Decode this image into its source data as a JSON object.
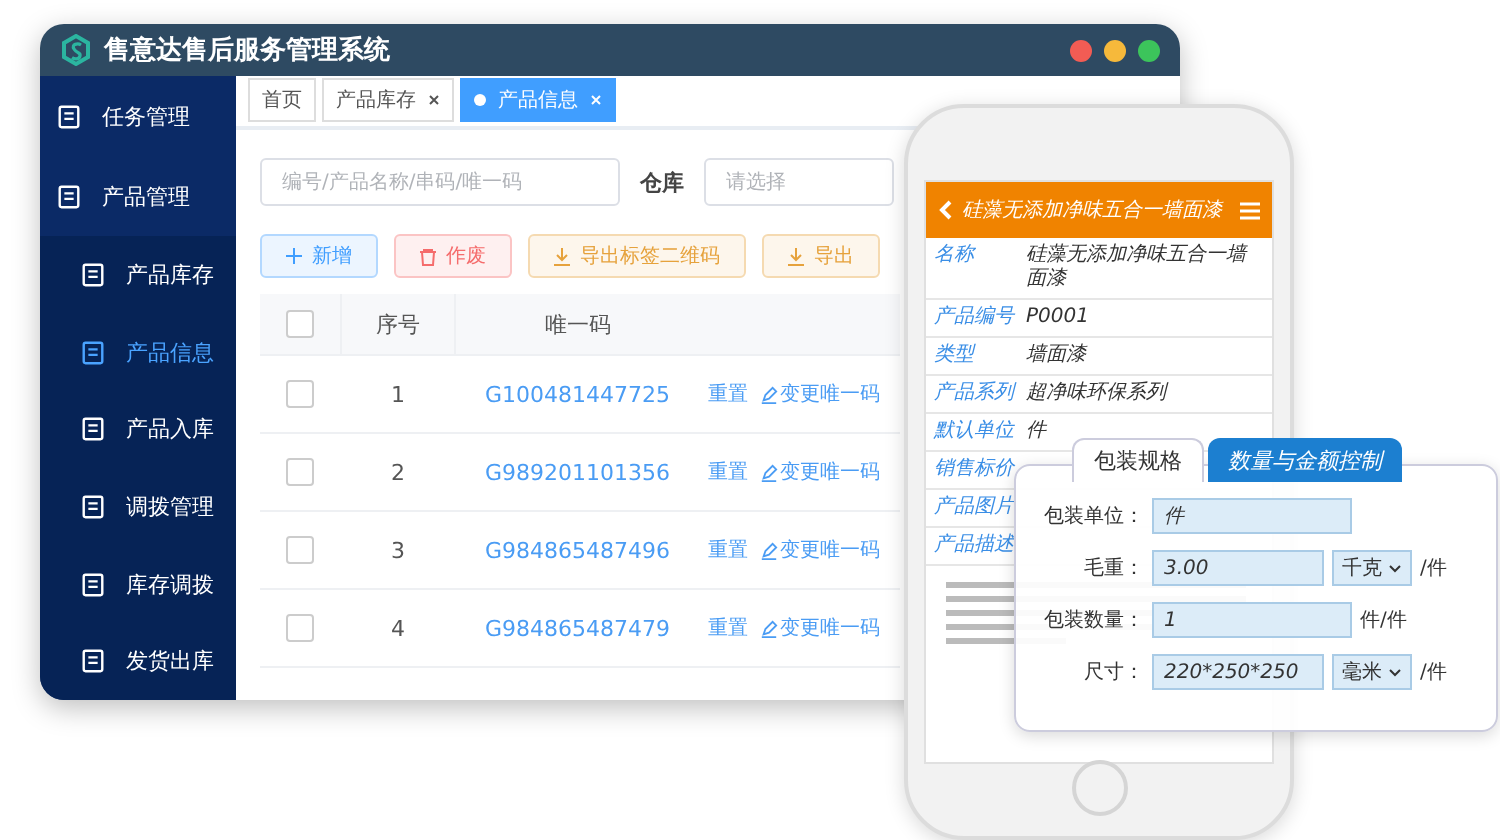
{
  "window": {
    "title": "售意达售后服务管理系统"
  },
  "sidebar": {
    "items": [
      {
        "label": "任务管理",
        "expanded": false
      },
      {
        "label": "产品管理",
        "expanded": true,
        "children": [
          {
            "label": "产品库存",
            "selected": false
          },
          {
            "label": "产品信息",
            "selected": true
          },
          {
            "label": "产品入库",
            "selected": false
          },
          {
            "label": "调拨管理",
            "selected": false
          },
          {
            "label": "库存调拨",
            "selected": false
          },
          {
            "label": "发货出库",
            "selected": false
          }
        ]
      }
    ]
  },
  "tabs": [
    {
      "label": "首页",
      "selected": false,
      "closable": false
    },
    {
      "label": "产品库存",
      "selected": false,
      "closable": true
    },
    {
      "label": "产品信息",
      "selected": true,
      "closable": true
    }
  ],
  "filters": {
    "search": {
      "placeholder": "编号/产品名称/串码/唯一码"
    },
    "warehouse": {
      "label": "仓库",
      "placeholder": "请选择"
    }
  },
  "toolbar": [
    {
      "label": "新增",
      "kind": "add"
    },
    {
      "label": "作废",
      "kind": "void"
    },
    {
      "label": "导出标签二维码",
      "kind": "export"
    },
    {
      "label": "导出",
      "kind": "export"
    }
  ],
  "table": {
    "all_checked": false,
    "columns": [
      "序号",
      "唯一码"
    ],
    "rows": [
      {
        "checked": false,
        "index": "1",
        "code": "G100481447725",
        "actions": [
          "重置",
          "变更唯一码"
        ]
      },
      {
        "checked": false,
        "index": "2",
        "code": "G989201101356",
        "actions": [
          "重置",
          "变更唯一码"
        ]
      },
      {
        "checked": false,
        "index": "3",
        "code": "G984865487496",
        "actions": [
          "重置",
          "变更唯一码"
        ]
      },
      {
        "checked": false,
        "index": "4",
        "code": "G984865487479",
        "actions": [
          "重置",
          "变更唯一码"
        ]
      }
    ]
  },
  "phone": {
    "title": "硅藻无添加净味五合一墙面漆",
    "fields": [
      {
        "label": "名称",
        "value": "硅藻无添加净味五合一墙面漆"
      },
      {
        "label": "产品编号",
        "value": "P0001"
      },
      {
        "label": "类型",
        "value": "墙面漆"
      },
      {
        "label": "产品系列",
        "value": "超净味环保系列"
      },
      {
        "label": "默认单位",
        "value": "件"
      },
      {
        "label": "销售标价"
      },
      {
        "label": "产品图片"
      },
      {
        "label": "产品描述"
      }
    ]
  },
  "card": {
    "tabs": [
      {
        "label": "包装规格",
        "selected": true
      },
      {
        "label": "数量与金额控制",
        "selected": false
      }
    ],
    "fields": [
      {
        "label": "包装单位：",
        "value": "件"
      },
      {
        "label": "毛重：",
        "value": "3.00",
        "unit": "千克",
        "suffix": "/件"
      },
      {
        "label": "包装数量：",
        "value": "1",
        "suffix": "件/件"
      },
      {
        "label": "尺寸：",
        "value": "220*250*250",
        "unit": "毫米",
        "suffix": "/件"
      }
    ]
  }
}
